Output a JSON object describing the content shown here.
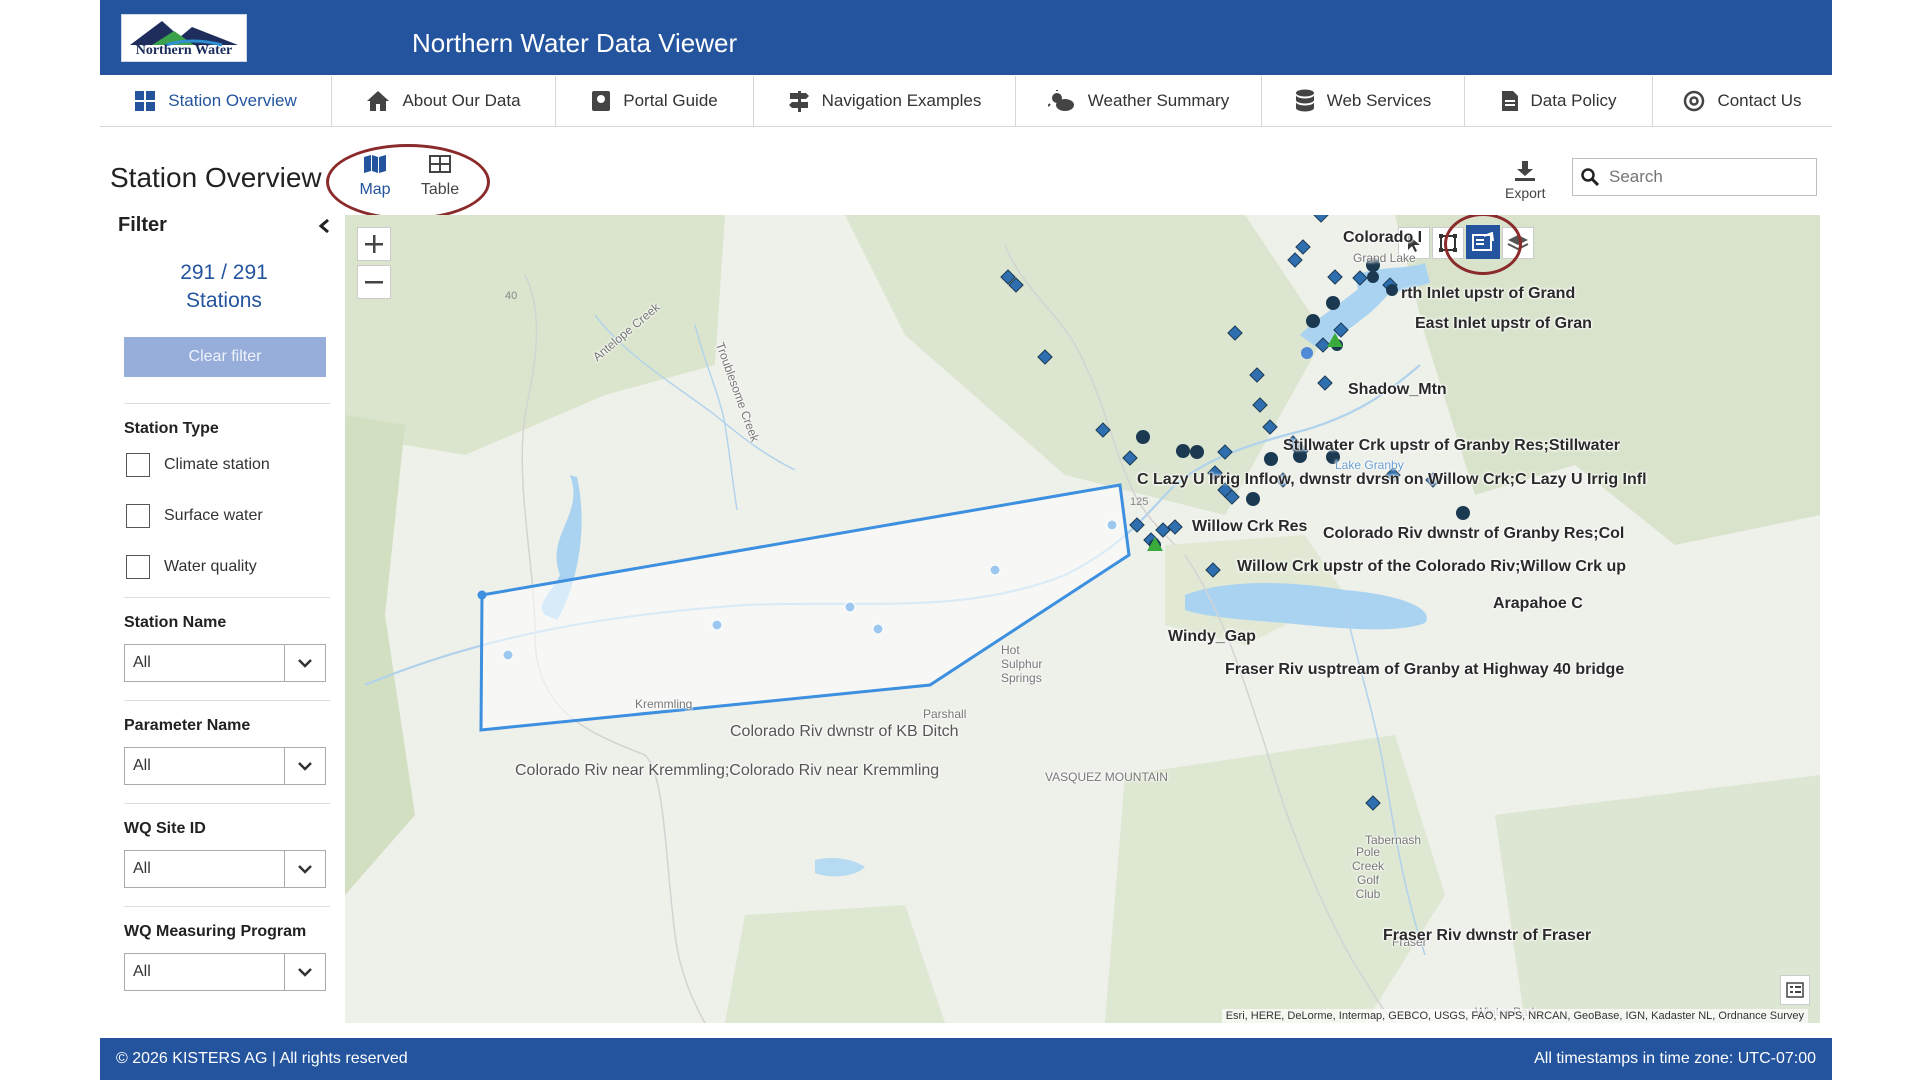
{
  "header": {
    "logo_text": "Northern Water",
    "title": "Northern Water Data Viewer"
  },
  "nav": [
    {
      "label": "Station Overview",
      "icon": "grid-icon",
      "active": true
    },
    {
      "label": "About Our Data",
      "icon": "home-icon"
    },
    {
      "label": "Portal Guide",
      "icon": "book-icon"
    },
    {
      "label": "Navigation Examples",
      "icon": "signpost-icon"
    },
    {
      "label": "Weather Summary",
      "icon": "cloud-sun-icon"
    },
    {
      "label": "Web Services",
      "icon": "database-icon"
    },
    {
      "label": "Data Policy",
      "icon": "document-icon"
    },
    {
      "label": "Contact Us",
      "icon": "at-icon"
    }
  ],
  "page": {
    "title": "Station Overview",
    "views": {
      "map": "Map",
      "table": "Table"
    },
    "export_label": "Export",
    "search_placeholder": "Search"
  },
  "filter": {
    "title": "Filter",
    "count_filtered": "291",
    "count_total": "291",
    "separator": "/",
    "count_unit": "Stations",
    "clear_label": "Clear filter",
    "station_type": {
      "title": "Station Type",
      "options": [
        "Climate station",
        "Surface water",
        "Water quality"
      ]
    },
    "selects": [
      {
        "title": "Station Name",
        "value": "All"
      },
      {
        "title": "Parameter Name",
        "value": "All"
      },
      {
        "title": "WQ Site ID",
        "value": "All"
      },
      {
        "title": "WQ Measuring Program",
        "value": "All"
      }
    ]
  },
  "map": {
    "station_labels": [
      "Colorado I",
      "rth Inlet upstr of Grand",
      "East Inlet upstr of Gran",
      "Shadow_Mtn",
      "Stillwater Crk upstr of Granby Res;Stillwater",
      "C Lazy U Irrig Inflow, dwnstr dvrsn on Willow Crk;C Lazy U Irrig Infl",
      "Willow Crk Res",
      "Colorado Riv dwnstr of Granby Res;Col",
      "Willow Crk upstr of the Colorado Riv;Willow Crk up",
      "Arapahoe C",
      "Windy_Gap",
      "Fraser Riv usptream of Granby at Highway 40 bridge",
      "Colorado Riv dwnstr of KB Ditch",
      "Colorado Riv near Kremmling;Colorado Riv near Kremmling",
      "Fraser Riv dwnstr of Fraser"
    ],
    "place_labels": [
      "Antelope Creek",
      "Troublesome Creek",
      "Kremmling",
      "Parshall",
      "Hot Sulphur Springs",
      "VASQUEZ MOUNTAIN",
      "Lake Granby",
      "Grand Lake",
      "Tabernash",
      "Pole Creek Golf Club",
      "Fraser",
      "Winter Park",
      "40",
      "125"
    ],
    "attribution": "Esri, HERE, DeLorme, Intermap, GEBCO, USGS, FAO, NPS, NRCAN, GeoBase, IGN, Kadaster NL, Ordnance Survey",
    "colors": {
      "polygon": "#3d8fe0",
      "station_dark": "#1b3a52",
      "station_diamond": "#2f6fb0",
      "station_light": "#9cc8ef",
      "station_green": "#3aaa3a"
    }
  },
  "footer": {
    "copyright": "© 2026 KISTERS AG | All rights reserved",
    "timezone": "All timestamps in time zone: UTC-07:00"
  }
}
